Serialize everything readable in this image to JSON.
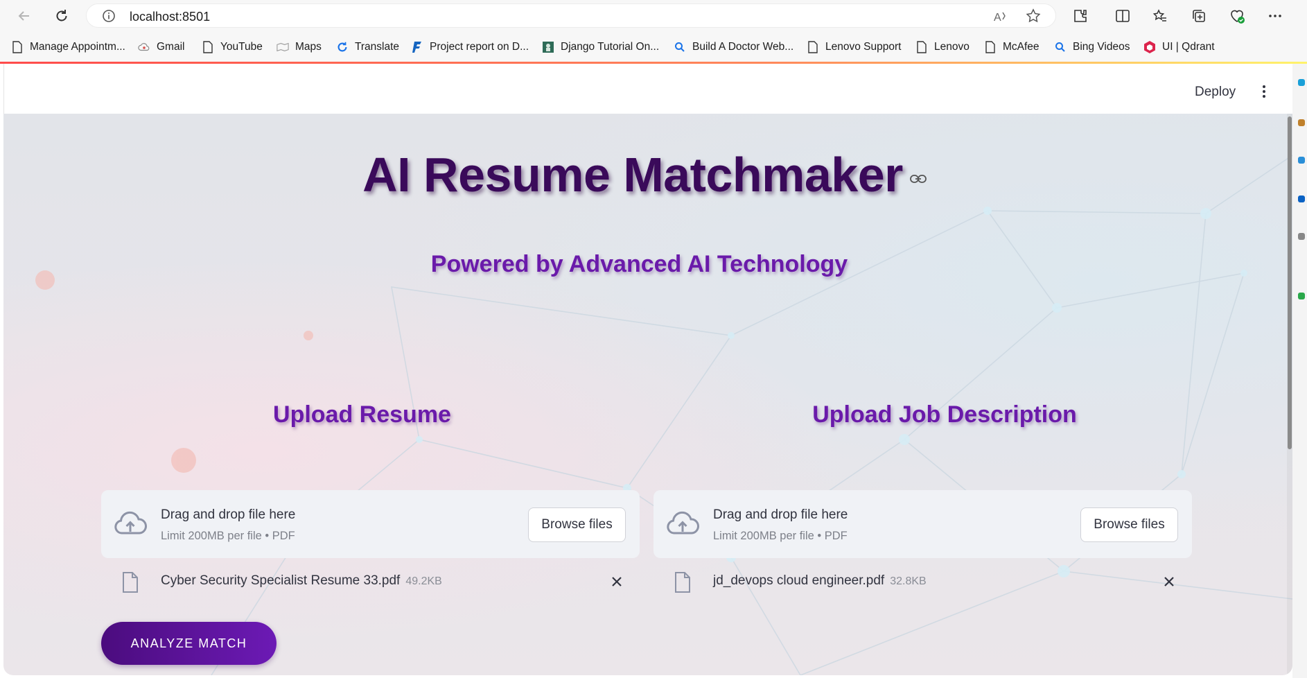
{
  "browser": {
    "url": "localhost:8501",
    "read_aloud_label": "A̩",
    "bookmarks": [
      {
        "label": "Manage Appointm...",
        "icon": "page-icon"
      },
      {
        "label": "Gmail",
        "icon": "cloud-icon"
      },
      {
        "label": "YouTube",
        "icon": "page-icon"
      },
      {
        "label": "Maps",
        "icon": "maps-icon"
      },
      {
        "label": "Translate",
        "icon": "translate-icon"
      },
      {
        "label": "Project report on D...",
        "icon": "f-logo-icon"
      },
      {
        "label": "Django Tutorial On...",
        "icon": "django-icon"
      },
      {
        "label": "Build A Doctor Web...",
        "icon": "bing-search-icon"
      },
      {
        "label": "Lenovo Support",
        "icon": "page-icon"
      },
      {
        "label": "Lenovo",
        "icon": "page-icon"
      },
      {
        "label": "McAfee",
        "icon": "page-icon"
      },
      {
        "label": "Bing Videos",
        "icon": "bing-search-icon"
      },
      {
        "label": "UI | Qdrant",
        "icon": "qdrant-icon"
      }
    ]
  },
  "header": {
    "deploy_label": "Deploy"
  },
  "main": {
    "title": "AI Resume Matchmaker",
    "subtitle": "Powered by Advanced AI Technology",
    "resume": {
      "heading": "Upload Resume",
      "drop_text": "Drag and drop file here",
      "limit_text": "Limit 200MB per file • PDF",
      "browse_label": "Browse files",
      "file_name": "Cyber Security Specialist Resume 33.pdf",
      "file_size": "49.2KB"
    },
    "job": {
      "heading": "Upload Job Description",
      "drop_text": "Drag and drop file here",
      "limit_text": "Limit 200MB per file • PDF",
      "browse_label": "Browse files",
      "file_name": "jd_devops cloud engineer.pdf",
      "file_size": "32.8KB"
    },
    "analyze_label": "ANALYZE MATCH"
  },
  "colors": {
    "title": "#3a0a5a",
    "accent_purple": "#6a1aaa",
    "button_gradient_start": "#4b0c7e",
    "button_gradient_end": "#6c1ab5",
    "uploader_bg": "#f0f2f6"
  }
}
